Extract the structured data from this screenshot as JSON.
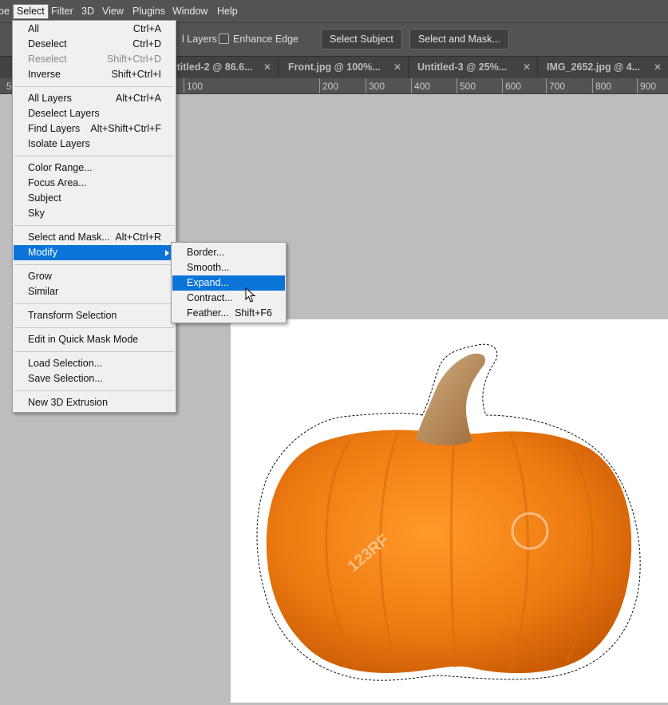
{
  "menubar": {
    "items": [
      {
        "label": "pe"
      },
      {
        "label": "Select"
      },
      {
        "label": "Filter"
      },
      {
        "label": "3D"
      },
      {
        "label": "View"
      },
      {
        "label": "Plugins"
      },
      {
        "label": "Window"
      },
      {
        "label": "Help"
      }
    ]
  },
  "options": {
    "sample_all_layers_label": "l Layers",
    "enhance_edge_label": "Enhance Edge",
    "select_subject_label": "Select Subject",
    "select_and_mask_label": "Select and Mask..."
  },
  "tabs": [
    {
      "label": "ntitled-2 @ 86.6..."
    },
    {
      "label": "Front.jpg @ 100%..."
    },
    {
      "label": "Untitled-3 @ 25%..."
    },
    {
      "label": "IMG_2652.jpg @ 4..."
    }
  ],
  "ruler": {
    "first_label": "5",
    "labels": [
      "100",
      "200",
      "300",
      "400",
      "500",
      "600",
      "700",
      "800",
      "900"
    ]
  },
  "select_menu": {
    "items": [
      {
        "label": "All",
        "shortcut": "Ctrl+A"
      },
      {
        "label": "Deselect",
        "shortcut": "Ctrl+D"
      },
      {
        "label": "Reselect",
        "shortcut": "Shift+Ctrl+D"
      },
      {
        "label": "Inverse",
        "shortcut": "Shift+Ctrl+I"
      },
      {
        "label": "All Layers",
        "shortcut": "Alt+Ctrl+A"
      },
      {
        "label": "Deselect Layers",
        "shortcut": ""
      },
      {
        "label": "Find Layers",
        "shortcut": "Alt+Shift+Ctrl+F"
      },
      {
        "label": "Isolate Layers",
        "shortcut": ""
      },
      {
        "label": "Color Range...",
        "shortcut": ""
      },
      {
        "label": "Focus Area...",
        "shortcut": ""
      },
      {
        "label": "Subject",
        "shortcut": ""
      },
      {
        "label": "Sky",
        "shortcut": ""
      },
      {
        "label": "Select and Mask...",
        "shortcut": "Alt+Ctrl+R"
      },
      {
        "label": "Modify",
        "shortcut": ""
      },
      {
        "label": "Grow",
        "shortcut": ""
      },
      {
        "label": "Similar",
        "shortcut": ""
      },
      {
        "label": "Transform Selection",
        "shortcut": ""
      },
      {
        "label": "Edit in Quick Mask Mode",
        "shortcut": ""
      },
      {
        "label": "Load Selection...",
        "shortcut": ""
      },
      {
        "label": "Save Selection...",
        "shortcut": ""
      },
      {
        "label": "New 3D Extrusion",
        "shortcut": ""
      }
    ]
  },
  "modify_menu": {
    "items": [
      {
        "label": "Border...",
        "shortcut": ""
      },
      {
        "label": "Smooth...",
        "shortcut": ""
      },
      {
        "label": "Expand...",
        "shortcut": ""
      },
      {
        "label": "Contract...",
        "shortcut": ""
      },
      {
        "label": "Feather...",
        "shortcut": "Shift+F6"
      }
    ]
  },
  "canvas": {
    "watermark_text": "123RF"
  },
  "colors": {
    "menu_highlight": "#0a74d9",
    "pumpkin": "#f07c12",
    "stem": "#b98a55"
  }
}
